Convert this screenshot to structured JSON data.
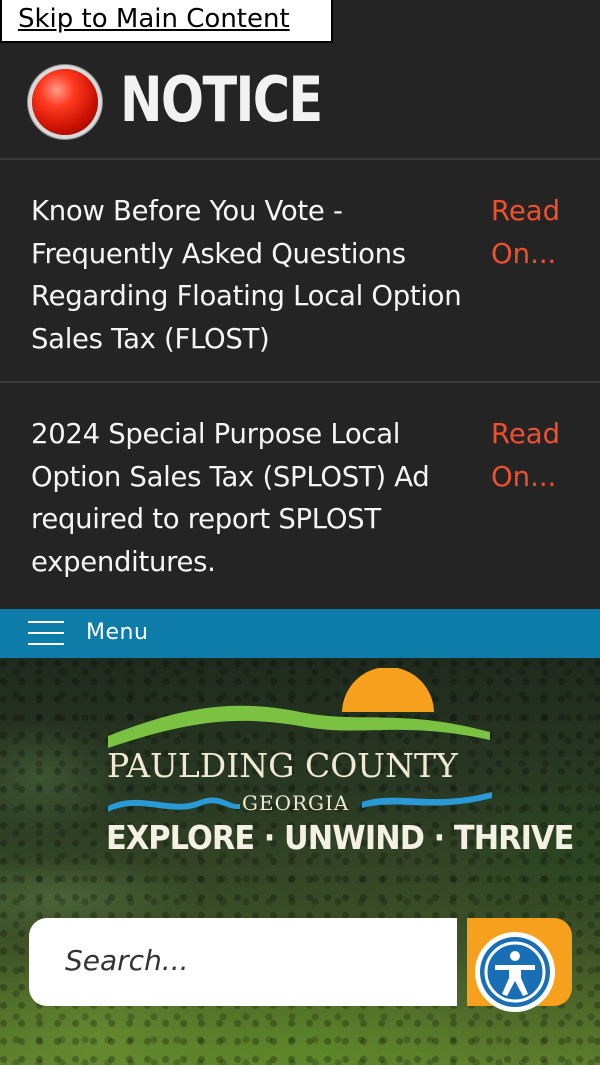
{
  "skip_link": "Skip to Main Content",
  "notice": {
    "title": "NOTICE",
    "items": [
      {
        "text": "Know Before You Vote - Frequently Asked Questions Regarding Floating Local Option Sales Tax (FLOST)",
        "read_more": "Read On..."
      },
      {
        "text": "2024 Special Purpose Local Option Sales Tax (SPLOST) Ad required to report SPLOST expenditures.",
        "read_more": "Read On..."
      }
    ]
  },
  "menu": {
    "label": "Menu"
  },
  "logo": {
    "line1": "PAULDING COUNTY",
    "line2": "GEORGIA",
    "tagline": "EXPLORE · UNWIND · THRIVE"
  },
  "search": {
    "placeholder": "Search..."
  },
  "icons": {
    "notice": "red-alert-dot-icon",
    "menu": "hamburger-icon",
    "accessibility": "accessibility-person-icon"
  },
  "colors": {
    "notice_bg": "#242424",
    "read_more": "#f0502e",
    "menu_bar": "#0e7ca8",
    "accent_orange": "#f7a01d",
    "logo_green": "#7cc242",
    "logo_blue": "#2a9ad6",
    "logo_sun": "#f7a01d"
  }
}
